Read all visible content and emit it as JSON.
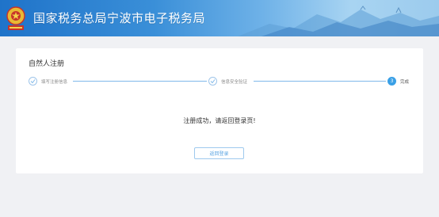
{
  "header": {
    "title": "国家税务总局宁波市电子税务局",
    "emblem_icon": "tax-emblem-icon"
  },
  "card": {
    "title": "自然人注册",
    "steps": [
      {
        "label": "填写注册信息",
        "state": "done",
        "icon": "check-icon"
      },
      {
        "label": "信息安全验证",
        "state": "done",
        "icon": "check-icon"
      },
      {
        "label": "完成",
        "state": "current",
        "number": "3"
      }
    ],
    "message": "注册成功，请返回登录页!",
    "back_button_label": "返回登录"
  },
  "colors": {
    "accent": "#3aa0e6",
    "header_start": "#1f73c9",
    "header_end": "#a8d4f2"
  }
}
